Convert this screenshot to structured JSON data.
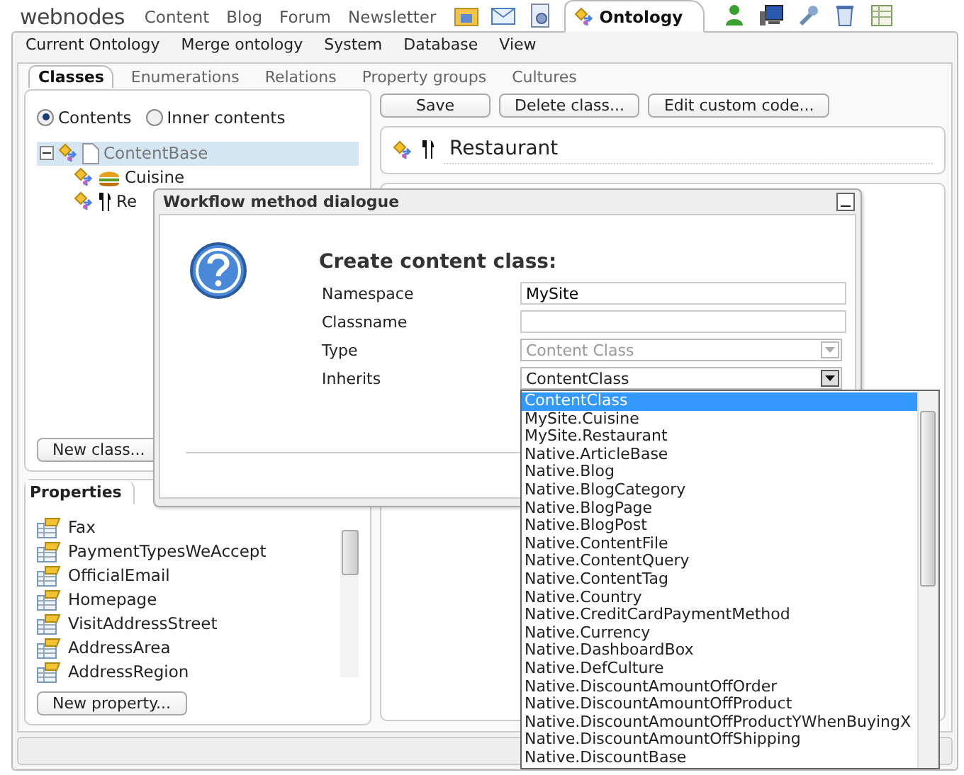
{
  "nav": {
    "logo": "webnodes",
    "links": [
      "Content",
      "Blog",
      "Forum",
      "Newsletter"
    ],
    "app_tabs": [
      {
        "label": "Ontology",
        "selected": true
      }
    ]
  },
  "menu": [
    "Current Ontology",
    "Merge ontology",
    "System",
    "Database",
    "View"
  ],
  "tabs": [
    {
      "label": "Classes",
      "selected": true
    },
    {
      "label": "Enumerations",
      "selected": false
    },
    {
      "label": "Relations",
      "selected": false
    },
    {
      "label": "Property groups",
      "selected": false
    },
    {
      "label": "Cultures",
      "selected": false
    }
  ],
  "classes_panel": {
    "radios": [
      {
        "label": "Contents",
        "selected": true
      },
      {
        "label": "Inner contents",
        "selected": false
      }
    ],
    "tree": [
      {
        "label": "ContentBase",
        "selected": true,
        "expanded": true,
        "children": [
          {
            "label": "Cuisine",
            "selected": false
          },
          {
            "label": "Re",
            "selected": false
          }
        ]
      }
    ],
    "button": "New class..."
  },
  "properties_panel": {
    "tab": "Properties",
    "items": [
      "Fax",
      "PaymentTypesWeAccept",
      "OfficialEmail",
      "Homepage",
      "VisitAddressStreet",
      "AddressArea",
      "AddressRegion"
    ],
    "button": "New property..."
  },
  "toolbar": [
    "Save",
    "Delete class...",
    "Edit custom code..."
  ],
  "class_name": "Restaurant",
  "dialog": {
    "title": "Workflow method dialogue",
    "heading": "Create content class:",
    "fields": [
      {
        "label": "Namespace",
        "kind": "text",
        "value": "MySite"
      },
      {
        "label": "Classname",
        "kind": "text"
      },
      {
        "label": "Type",
        "kind": "select",
        "value": "Content Class",
        "disabled": true,
        "expanded": false
      },
      {
        "label": "Inherits",
        "kind": "select",
        "value": "ContentClass",
        "disabled": false,
        "expanded": true,
        "options": [
          {
            "label": "ContentClass",
            "selected": true
          },
          {
            "label": "MySite.Cuisine",
            "selected": false
          },
          {
            "label": "MySite.Restaurant",
            "selected": false
          },
          {
            "label": "Native.ArticleBase",
            "selected": false
          },
          {
            "label": "Native.Blog",
            "selected": false
          },
          {
            "label": "Native.BlogCategory",
            "selected": false
          },
          {
            "label": "Native.BlogPage",
            "selected": false
          },
          {
            "label": "Native.BlogPost",
            "selected": false
          },
          {
            "label": "Native.ContentFile",
            "selected": false
          },
          {
            "label": "Native.ContentQuery",
            "selected": false
          },
          {
            "label": "Native.ContentTag",
            "selected": false
          },
          {
            "label": "Native.Country",
            "selected": false
          },
          {
            "label": "Native.CreditCardPaymentMethod",
            "selected": false
          },
          {
            "label": "Native.Currency",
            "selected": false
          },
          {
            "label": "Native.DashboardBox",
            "selected": false
          },
          {
            "label": "Native.DefCulture",
            "selected": false
          },
          {
            "label": "Native.DiscountAmountOffOrder",
            "selected": false
          },
          {
            "label": "Native.DiscountAmountOffProduct",
            "selected": false
          },
          {
            "label": "Native.DiscountAmountOffProductYWhenBuyingX",
            "selected": false
          },
          {
            "label": "Native.DiscountAmountOffShipping",
            "selected": false
          },
          {
            "label": "Native.DiscountBase",
            "selected": false
          }
        ]
      }
    ]
  }
}
